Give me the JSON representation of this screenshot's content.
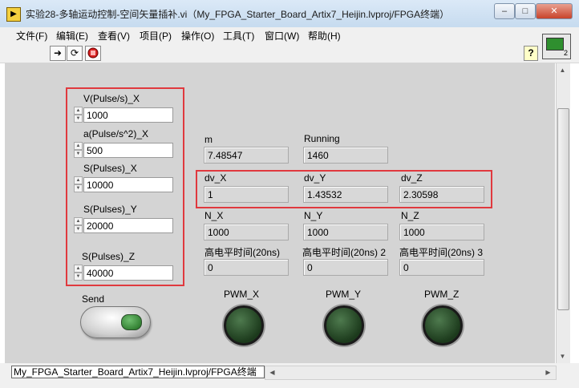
{
  "window": {
    "title": "实验28-多轴运动控制-空间矢量插补.vi（My_FPGA_Starter_Board_Artix7_Heijin.lvproj/FPGA终端）",
    "app_icon": "labview-vi-icon"
  },
  "menu": [
    "文件(F)",
    "编辑(E)",
    "查看(V)",
    "项目(P)",
    "操作(O)",
    "工具(T)",
    "窗口(W)",
    "帮助(H)"
  ],
  "toolbar": {
    "buttons": [
      "run-arrow-icon",
      "run-continuous-icon",
      "abort-stop-icon"
    ],
    "help_label": "?",
    "connector_number": "2"
  },
  "controls": {
    "vx": {
      "label": "V(Pulse/s)_X",
      "value": "1000"
    },
    "ax": {
      "label": "a(Pulse/s^2)_X",
      "value": "500"
    },
    "sx": {
      "label": "S(Pulses)_X",
      "value": "10000"
    },
    "sy": {
      "label": "S(Pulses)_Y",
      "value": "20000"
    },
    "sz": {
      "label": "S(Pulses)_Z",
      "value": "40000"
    },
    "send": {
      "label": "Send"
    }
  },
  "indicators": {
    "m": {
      "label": "m",
      "value": "7.48547"
    },
    "running": {
      "label": "Running",
      "value": "1460"
    },
    "dv_x": {
      "label": "dv_X",
      "value": "1"
    },
    "dv_y": {
      "label": "dv_Y",
      "value": "1.43532"
    },
    "dv_z": {
      "label": "dv_Z",
      "value": "2.30598"
    },
    "n_x": {
      "label": "N_X",
      "value": "1000"
    },
    "n_y": {
      "label": "N_Y",
      "value": "1000"
    },
    "n_z": {
      "label": "N_Z",
      "value": "1000"
    },
    "hi_1": {
      "label": "高电平时间(20ns)",
      "value": "0"
    },
    "hi_2": {
      "label": "高电平时间(20ns) 2",
      "value": "0"
    },
    "hi_3": {
      "label": "高电平时间(20ns) 3",
      "value": "0"
    },
    "pwm_x": {
      "label": "PWM_X"
    },
    "pwm_y": {
      "label": "PWM_Y"
    },
    "pwm_z": {
      "label": "PWM_Z"
    }
  },
  "status": {
    "path": "My_FPGA_Starter_Board_Artix7_Heijin.lvproj/FPGA终端"
  },
  "colors": {
    "highlight_frame": "#e0393e",
    "panel": "#d4d4d4",
    "led_off": "#1c3a1c"
  }
}
